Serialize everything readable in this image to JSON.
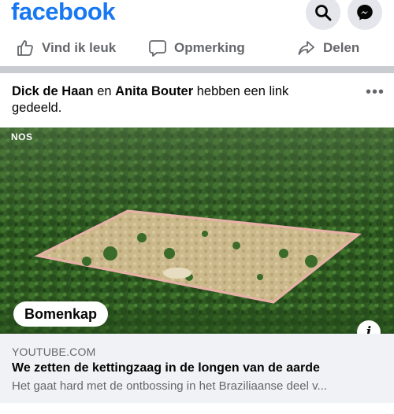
{
  "header": {
    "logo": "facebook",
    "search_icon": "search-icon",
    "messenger_icon": "messenger-icon"
  },
  "actions": {
    "like": "Vind ik leuk",
    "comment": "Opmerking",
    "share": "Delen"
  },
  "post": {
    "user1": "Dick de Haan",
    "connector": " en ",
    "user2": "Anita Bouter",
    "action_text": " hebben een link gedeeld.",
    "more": "•••"
  },
  "media": {
    "watermark": "NOS",
    "tag": "Bomenkap",
    "info": "i"
  },
  "link": {
    "source": "YOUTUBE.COM",
    "title": "We zetten de kettingzaag in de longen van de aarde",
    "description": "Het gaat hard met de ontbossing in het Braziliaanse deel v..."
  },
  "colors": {
    "brand": "#1877f2",
    "muted": "#65676b",
    "panel": "#f0f2f5"
  }
}
